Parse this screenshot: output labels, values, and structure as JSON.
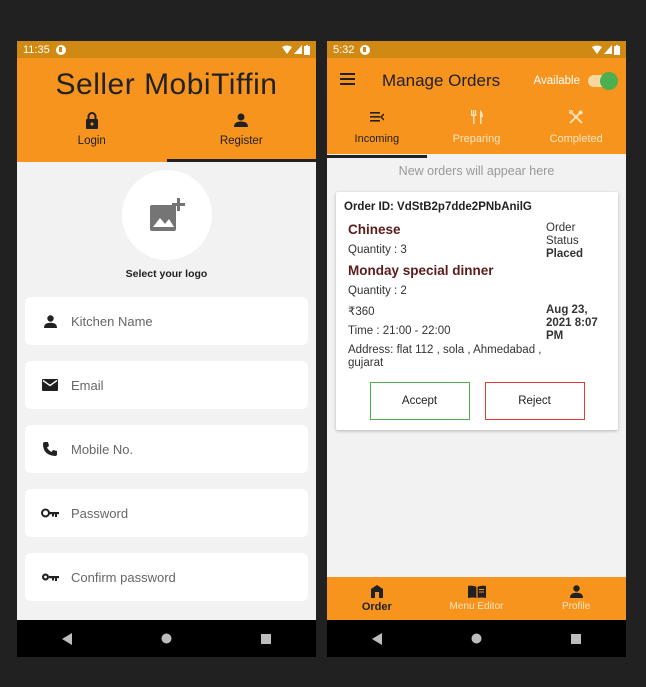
{
  "left": {
    "status": {
      "time": "11:35"
    },
    "app_title": "Seller MobiTiffin",
    "tabs": [
      {
        "label": "Login",
        "icon": "lock-icon"
      },
      {
        "label": "Register",
        "icon": "person-icon"
      }
    ],
    "logo_label": "Select your logo",
    "fields": [
      {
        "placeholder": "Kitchen Name",
        "icon": "person-icon"
      },
      {
        "placeholder": "Email",
        "icon": "mail-icon"
      },
      {
        "placeholder": "Mobile No.",
        "icon": "phone-icon"
      },
      {
        "placeholder": "Password",
        "icon": "key-icon"
      },
      {
        "placeholder": "Confirm password",
        "icon": "key-icon"
      }
    ]
  },
  "right": {
    "status": {
      "time": "5:32"
    },
    "title": "Manage Orders",
    "available_label": "Available",
    "tabs": [
      {
        "label": "Incoming",
        "icon": "incoming-icon"
      },
      {
        "label": "Preparing",
        "icon": "fork-knife-icon"
      },
      {
        "label": "Completed",
        "icon": "crossed-utensils-icon"
      }
    ],
    "hint": "New orders will appear here",
    "order": {
      "id_label": "Order ID: VdStB2p7dde2PNbAnilG",
      "items": [
        {
          "name": "Chinese",
          "quantity": "Quantity : 3"
        },
        {
          "name": "Monday special dinner",
          "quantity": "Quantity : 2"
        }
      ],
      "price": "₹360",
      "time": "Time : 21:00 - 22:00",
      "address": "Address: flat 112  , sola , Ahmedabad , gujarat",
      "status_label": "Order Status",
      "status_value": "Placed",
      "date": "Aug 23, 2021 8:07 PM",
      "accept_label": "Accept",
      "reject_label": "Reject"
    },
    "bottom_nav": [
      {
        "label": "Order",
        "icon": "store-icon"
      },
      {
        "label": "Menu Editor",
        "icon": "menu-book-icon"
      },
      {
        "label": "Profile",
        "icon": "person-icon"
      }
    ]
  },
  "colors": {
    "primary": "#f7941d",
    "status_bar": "#d08a14",
    "item_name": "#5c1b1b",
    "accept": "#4caf50",
    "reject": "#e53935"
  }
}
